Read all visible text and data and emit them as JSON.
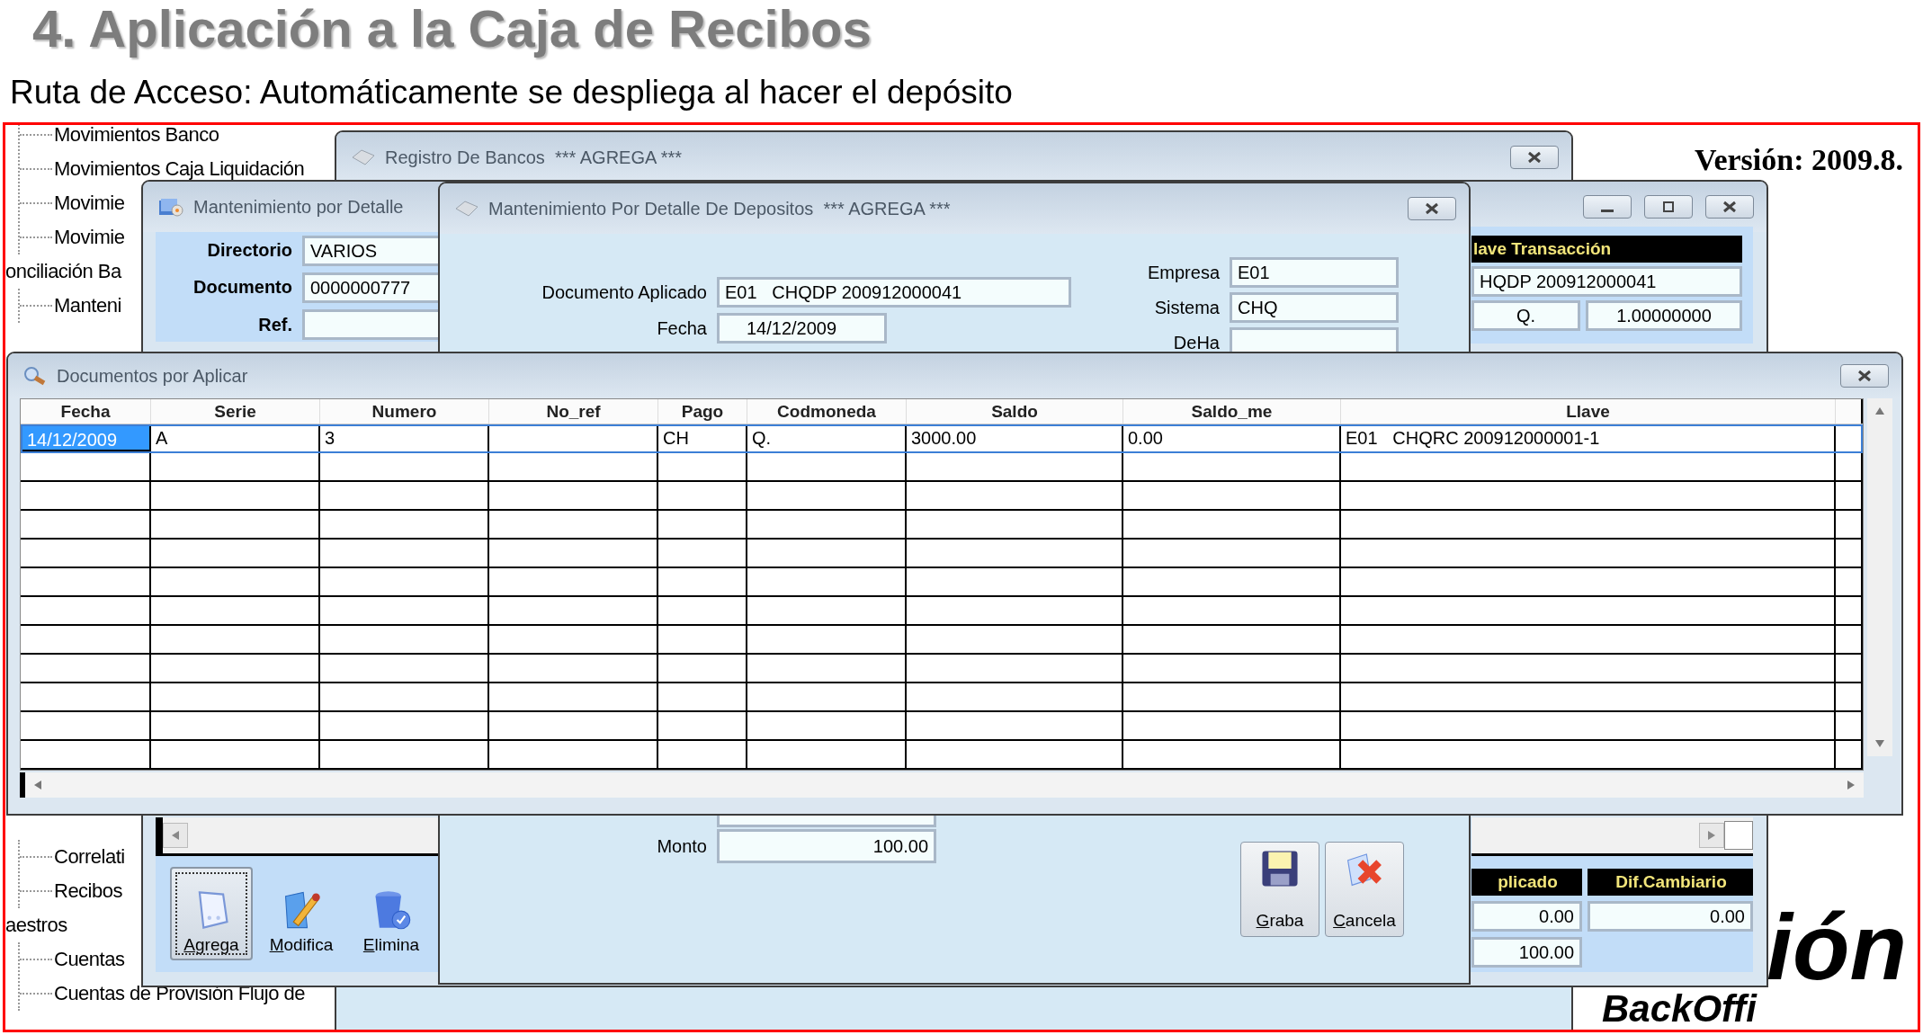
{
  "page": {
    "title": "4. Aplicación a la Caja de Recibos",
    "subtitle": "Ruta de Acceso: Automáticamente se despliega al hacer el depósito"
  },
  "tree": {
    "sections": [
      {
        "nodes": [
          {
            "children": [
              {
                "label": "Movimientos Banco"
              },
              {
                "label": "Movimientos Caja Liquidación"
              },
              {
                "label": "Movimie"
              },
              {
                "label": "Movimie"
              }
            ]
          },
          {
            "label": "onciliación Ba",
            "children": [
              {
                "label": "Manteni"
              }
            ]
          }
        ]
      },
      {
        "nodes": [
          {
            "children": [
              {
                "label": "Correlati"
              },
              {
                "label": "Recibos"
              }
            ]
          },
          {
            "label": "aestros",
            "children": [
              {
                "label": "Cuentas"
              },
              {
                "label": "Cuentas de Provisión Flujo de"
              }
            ]
          }
        ]
      }
    ]
  },
  "version": "Versión: 2009.8.",
  "logo": {
    "line_1": "ión",
    "line_2": "BackOffi"
  },
  "registro_window": {
    "title": "Registro De Bancos  *** AGREGA ***"
  },
  "detalle_window": {
    "title": "Mantenimiento por Detalle",
    "fields": [
      {
        "label": "Directorio",
        "value": "VARIOS"
      },
      {
        "label": "Documento",
        "value": "0000000777"
      },
      {
        "label": "Ref."
      }
    ],
    "transaction": {
      "header": "lave Transacción",
      "key": "HQDP 200912000041",
      "currency": "Q.",
      "rate": "1.00000000"
    },
    "toolbar": [
      {
        "label": "Agrega",
        "kind": "add",
        "selected": true
      },
      {
        "label": "Modifica",
        "kind": "edit",
        "selected": false
      },
      {
        "label": "Elimina",
        "kind": "delete",
        "selected": false
      }
    ],
    "totals": {
      "headers": [
        "plicado",
        "Dif.Cambiario"
      ],
      "applied": "0.00",
      "difference": "0.00",
      "total": "100.00"
    }
  },
  "depositos_window": {
    "title": "Mantenimiento Por Detalle De Depositos  *** AGREGA ***",
    "left_fields": [
      {
        "label": "Documento Aplicado",
        "value": "E01   CHQDP 200912000041",
        "kind": "wide"
      },
      {
        "label": "Fecha",
        "value": "14/12/2009",
        "kind": "date"
      }
    ],
    "right_fields": [
      {
        "label": "Empresa",
        "value": "E01"
      },
      {
        "label": "Sistema",
        "value": "CHQ"
      },
      {
        "label": "DeHa"
      }
    ],
    "monto": {
      "label": "Monto",
      "value": "100.00"
    },
    "buttons": [
      {
        "label": "Graba",
        "kind": "save"
      },
      {
        "label": "Cancela",
        "kind": "cancel"
      }
    ]
  },
  "documentos_window": {
    "title": "Documentos por Aplicar",
    "table": {
      "columns": [
        "Fecha",
        "Serie",
        "Numero",
        "No_ref",
        "Pago",
        "Codmoneda",
        "Saldo",
        "Saldo_me",
        "Llave"
      ],
      "rows": [
        {
          "selected": true,
          "cells": [
            "14/12/2009",
            "A",
            "3",
            "",
            "CH",
            "Q.",
            "3000.00",
            "0.00",
            "E01   CHQRC 200912000001-1"
          ]
        }
      ]
    }
  }
}
